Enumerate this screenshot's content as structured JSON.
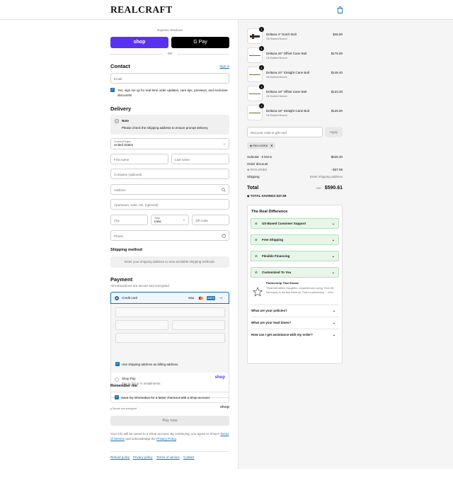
{
  "brand": {
    "logo": "REALCRAFT"
  },
  "express": {
    "label": "Express checkout",
    "shop_pay": "shop",
    "gpay": "G Pay",
    "or": "OR"
  },
  "contact": {
    "heading": "Contact",
    "sign_in": "Sign in",
    "email_placeholder": "Email",
    "marketing_label": "Yes, sign me up for real-time order updates, care tips, previews, and exclusive discounts!"
  },
  "delivery": {
    "heading": "Delivery",
    "note_title": "Note",
    "note_text": "Please check the shipping address to ensure prompt delivery",
    "country_label": "Country/Region",
    "country_value": "United States",
    "first_name": "First name",
    "last_name": "Last name",
    "company": "Company (optional)",
    "address": "Address",
    "apartment": "Apartment, suite, etc. (optional)",
    "city": "City",
    "state_label": "State",
    "state_value": "Iowa",
    "zip": "ZIP code",
    "phone": "Phone"
  },
  "shipping_method": {
    "heading": "Shipping method",
    "info": "Enter your shipping address to view available shipping methods."
  },
  "payment": {
    "heading": "Payment",
    "subtitle": "All transactions are secure and encrypted.",
    "credit_card": "Credit card",
    "card_badges": [
      "VISA",
      "MC",
      "AMEX",
      "+4"
    ],
    "billing_same": "Use shipping address as billing address",
    "shop_pay_title": "Shop Pay",
    "shop_pay_sub": "Pay in full or in installments",
    "shop_pay_logo": "shop"
  },
  "remember": {
    "heading": "Remember me",
    "save_info": "Save my information for a faster checkout with a Shop account",
    "secure": "Secure and encrypted",
    "shop_logo": "shop"
  },
  "pay_now": "Pay now",
  "legal": {
    "text1": "Your info will be saved to a Shop account. By continuing, you agree to Shop's",
    "terms": "Terms of Service",
    "text2": "and acknowledge the",
    "privacy": "Privacy Policy",
    "end": "."
  },
  "footer_links": [
    "Refund policy",
    "Privacy policy",
    "Terms of service",
    "Contact"
  ],
  "cart": {
    "items": [
      {
        "name": "Deltana 4\" Dutch Bolt",
        "variant": "Oil-Rubbed Bronze",
        "price": "$46.60",
        "qty": "1"
      },
      {
        "name": "Deltana 26\" Offset Cane Bolt",
        "variant": "Oil-Rubbed Bronze",
        "price": "$175.00",
        "qty": "1"
      },
      {
        "name": "Deltana 24\" Straight Cane Bolt",
        "variant": "Oil-Rubbed Bronze",
        "price": "$148.40",
        "qty": "1"
      },
      {
        "name": "Deltana 18\" Offset Cane Bolt",
        "variant": "Oil-Rubbed Bronze",
        "price": "$133.30",
        "qty": "1"
      },
      {
        "name": "Deltana 18\" Straight Cane Bolt",
        "variant": "Oil-Rubbed Bronze",
        "price": "$125.00",
        "qty": "1"
      }
    ],
    "discount_placeholder": "Discount code or gift card",
    "apply": "Apply",
    "code_tag": "PAYLOOE6",
    "subtotal_label": "Subtotal · 5 items",
    "subtotal_value": "$628.30",
    "order_discount": "Order discount",
    "discount_code": "PAYLOOE6",
    "discount_value": "- $37.69",
    "shipping_label": "Shipping",
    "shipping_value": "Enter shipping address",
    "total_label": "Total",
    "currency": "USD",
    "total_value": "$590.61",
    "savings_label": "TOTAL SAVINGS",
    "savings_value": "$37.69"
  },
  "real_difference": {
    "heading": "The Real Difference",
    "features": [
      "US-Based Customer Support",
      "Free Shipping",
      "Flexible Financing",
      "Customized To You"
    ],
    "testimonial_title": "Partnership That Shows",
    "testimonial_text": "\"RealCraft skilled, thoughtful, competent and caring. From the first inquiry to the final follow-up. That's a partnership.\"",
    "testimonial_author": "- John",
    "faqs": [
      "What are your policies?",
      "What are your lead times?",
      "How can I get assistance with my order?"
    ]
  },
  "colors": {
    "accent": "#1773b0",
    "shop_purple": "#5a31f4",
    "success_bg": "#e7f6e9"
  }
}
